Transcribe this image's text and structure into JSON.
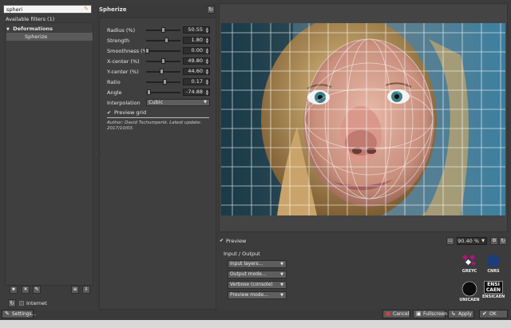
{
  "search": {
    "value": "spheri"
  },
  "filters": {
    "header": "Available filters (1)",
    "category": "Deformations",
    "item": "Spherize"
  },
  "internet": {
    "label": "Internet"
  },
  "filter_panel": {
    "title": "Spherize",
    "params": [
      {
        "label": "Radius (%)",
        "value": "50.55",
        "level": 0.5
      },
      {
        "label": "Strength",
        "value": "1.80",
        "level": 0.58
      },
      {
        "label": "Smoothness (%)",
        "value": "0.00",
        "level": 0.0
      },
      {
        "label": "X-center (%)",
        "value": "49.80",
        "level": 0.5
      },
      {
        "label": "Y-center (%)",
        "value": "44.60",
        "level": 0.45
      },
      {
        "label": "Ratio",
        "value": "0.17",
        "level": 0.55
      },
      {
        "label": "Angle",
        "value": "-74.88",
        "level": 0.04
      }
    ],
    "interpolation": {
      "label": "Interpolation",
      "value": "Cubic"
    },
    "preview_grid": "Preview grid",
    "author_line1": "Author: David Tschumperlé. Latest update:",
    "author_line2": "2017/10/03."
  },
  "preview": {
    "label": "Preview",
    "zoom": "90.40 %"
  },
  "io": {
    "header": "Input / Output",
    "input_layers": "Input layers...",
    "output_mode": "Output mode...",
    "verbose": "Verbose (console)",
    "preview_mode": "Preview mode..."
  },
  "logos": {
    "greyc": "GREYC",
    "cnrs": "CNRS",
    "unicaen": "UNICAEN",
    "ensicaen_top": "ENSI",
    "ensicaen_mid": "CAEN",
    "ensicaen": "ENSICAEN"
  },
  "buttons": {
    "settings": "Settings...",
    "cancel": "Cancel",
    "fullscreen": "Fullscreen",
    "apply": "Apply",
    "ok": "OK"
  }
}
